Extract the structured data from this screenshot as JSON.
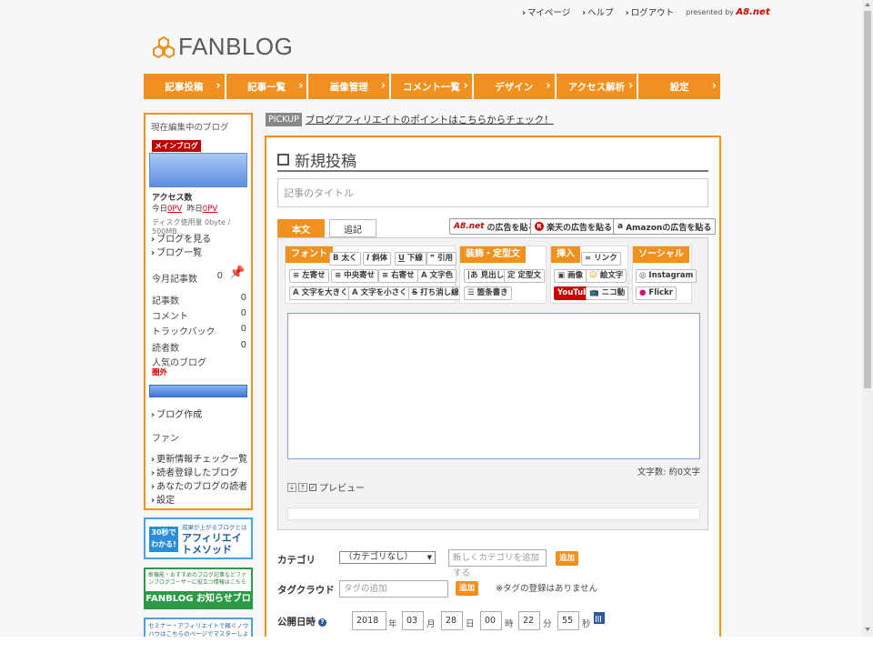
{
  "header": {
    "links": [
      "マイページ",
      "ヘルプ",
      "ログアウト"
    ],
    "presented_by": "presented by",
    "presented_brand": "A8.net"
  },
  "logo": {
    "text": "FANBLOG"
  },
  "nav": {
    "items": [
      "記事投稿",
      "記事一覧",
      "画像管理",
      "コメント一覧",
      "デザイン",
      "アクセス解析",
      "設定"
    ]
  },
  "sidebar": {
    "heading": "現在編集中のブログ",
    "badge": "メインブログ",
    "access_label": "アクセス数",
    "today_label": "今日",
    "today_value": "0PV",
    "yesterday_label": "昨日",
    "yesterday_value": "0PV",
    "disk": "ディスク使用量 0byte / 500MB",
    "view_blog": "ブログを見る",
    "blog_list": "ブログ一覧",
    "month_posts_label": "今月記事数",
    "month_posts_value": "0",
    "stats": [
      {
        "label": "記事数",
        "value": "0"
      },
      {
        "label": "コメント",
        "value": "0"
      },
      {
        "label": "トラックバック",
        "value": "0"
      },
      {
        "label": "読者数",
        "value": "0"
      }
    ],
    "popular_label": "人気のブログ",
    "popular_rank": "圏外",
    "create_blog": "ブログ作成",
    "fan_heading": "ファン",
    "fan_links": [
      "更新情報チェック一覧",
      "読者登録したブログ",
      "あなたのブログの読者",
      "設定"
    ]
  },
  "banners": {
    "b1_badge": "30秒でわかる!",
    "b1_small": "成果が上がるブログとは",
    "b1_big": "アフィリエイトメソッド",
    "b2_small": "新機能・おすすめのブログ記事などファンブログユーザーに役立つ情報はこちら",
    "b2_big": "FANBLOG お知らせブログ",
    "b3_small": "セミナー・アフィリエイトで稼ぐノウハウはこちらのページでマスターしよう!"
  },
  "pickup": {
    "tag": "PICKUP",
    "link": "ブログアフィリエイトのポイントはこちらからチェック！"
  },
  "editor": {
    "page_title": "新規投稿",
    "title_placeholder": "記事のタイトル",
    "tab_body": "本文",
    "tab_extra": "追記",
    "ad_a8": "の広告を貼る",
    "ad_a8_mark": "A8.net",
    "ad_rakuten": "楽天の広告を貼る",
    "ad_amazon": "Amazonの広告を貼る",
    "groups": {
      "font": "フォント",
      "deco": "装飾・定型文",
      "insert": "挿入",
      "social": "ソーシャル"
    },
    "buttons": {
      "bold": "太く",
      "italic": "斜体",
      "underline": "下線",
      "quote": "引用",
      "left": "左寄せ",
      "center": "中央寄せ",
      "right": "右寄せ",
      "color": "文字色",
      "bigger": "文字を大きく",
      "smaller": "文字を小さく",
      "strike": "打ち消し線",
      "heading": "見出し",
      "template": "定型文",
      "list": "箇条書き",
      "link": "リンク",
      "image": "画像",
      "emoji": "絵文字",
      "youtube": "YouTube",
      "niconico": "ニコ動",
      "instagram": "Instagram",
      "flickr": "Flickr"
    },
    "char_count": "文字数: 約0文字",
    "preview": "プレビュー"
  },
  "form": {
    "category_label": "カテゴリ",
    "category_value": "（カテゴリなし）",
    "category_new_placeholder": "新しくカテゴリを追加する",
    "add_label": "追加",
    "tag_label": "タグクラウド",
    "tag_placeholder": "タグの追加",
    "tag_note": "※タグの登録はありません",
    "date_label": "公開日時",
    "year": "2018",
    "year_unit": "年",
    "month": "03",
    "month_unit": "月",
    "day": "28",
    "day_unit": "日",
    "hour": "00",
    "hour_unit": "時",
    "minute": "22",
    "minute_unit": "分",
    "second": "55",
    "second_unit": "秒"
  },
  "colors": {
    "accent": "#f0901e",
    "badge_red": "#bb0000",
    "link_blue": "#2b5a9c"
  }
}
